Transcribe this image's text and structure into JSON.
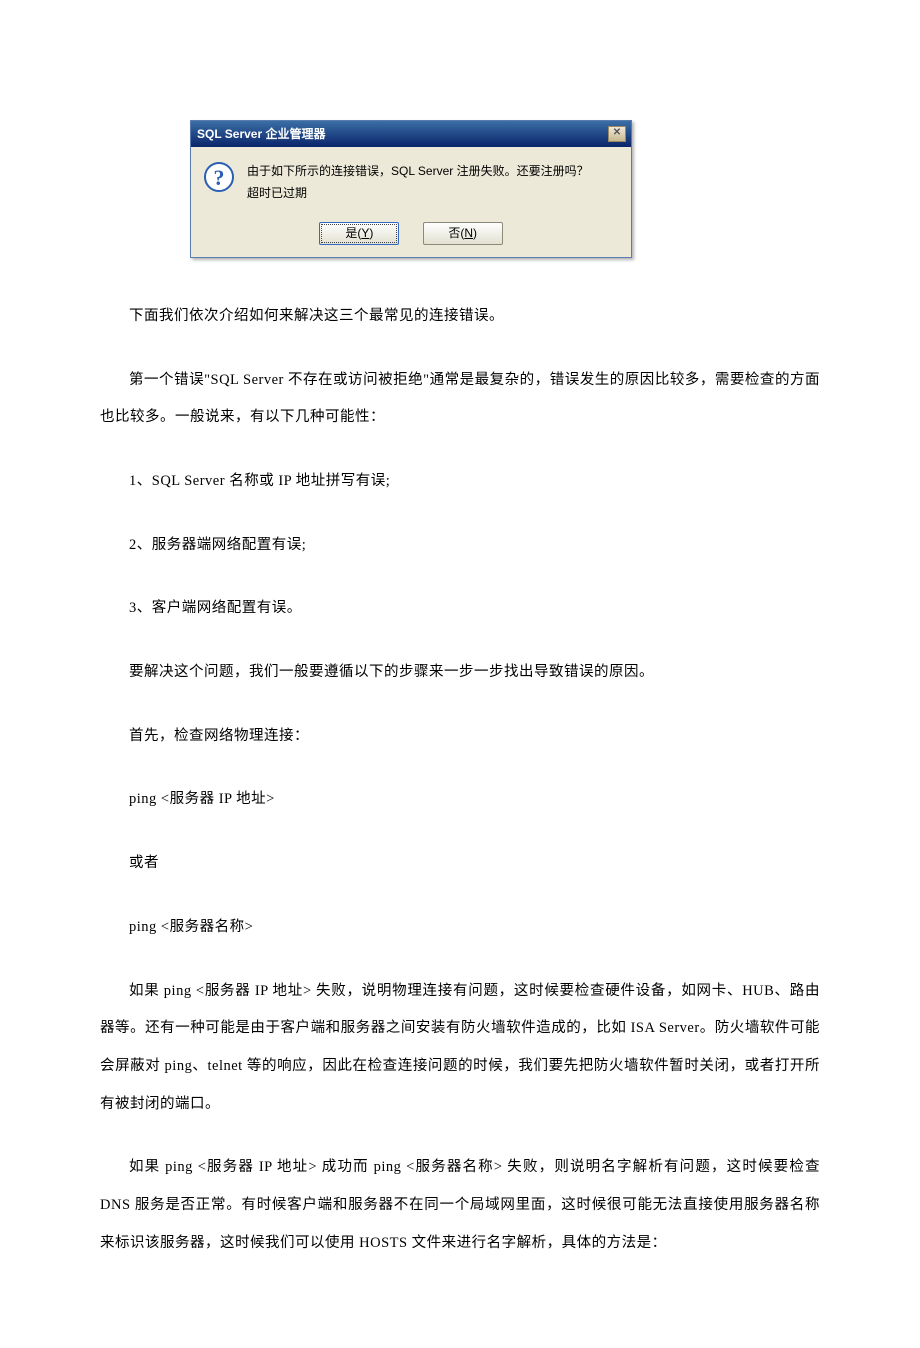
{
  "dialog": {
    "title": "SQL Server 企业管理器",
    "message_line1": "由于如下所示的连接错误，SQL Server 注册失败。还要注册吗？",
    "message_line2": "超时已过期",
    "btn_yes": "是(Y)",
    "btn_no": "否(N)"
  },
  "body": {
    "p1": "下面我们依次介绍如何来解决这三个最常见的连接错误。",
    "p2": "第一个错误\"SQL Server 不存在或访问被拒绝\"通常是最复杂的，错误发生的原因比较多，需要检查的方面也比较多。一般说来，有以下几种可能性：",
    "p3": "1、SQL Server 名称或 IP 地址拼写有误;",
    "p4": "2、服务器端网络配置有误;",
    "p5": "3、客户端网络配置有误。",
    "p6": "要解决这个问题，我们一般要遵循以下的步骤来一步一步找出导致错误的原因。",
    "p7": "首先，检查网络物理连接：",
    "p8": "ping <服务器 IP 地址>",
    "p9": "或者",
    "p10": "ping <服务器名称>",
    "p11": "如果 ping <服务器 IP 地址> 失败，说明物理连接有问题，这时候要检查硬件设备，如网卡、HUB、路由器等。还有一种可能是由于客户端和服务器之间安装有防火墙软件造成的，比如 ISA Server。防火墙软件可能会屏蔽对 ping、telnet 等的响应，因此在检查连接问题的时候，我们要先把防火墙软件暂时关闭，或者打开所有被封闭的端口。",
    "p12": "如果 ping <服务器 IP 地址> 成功而 ping <服务器名称> 失败，则说明名字解析有问题，这时候要检查 DNS 服务是否正常。有时候客户端和服务器不在同一个局域网里面，这时候很可能无法直接使用服务器名称来标识该服务器，这时候我们可以使用 HOSTS 文件来进行名字解析，具体的方法是："
  }
}
